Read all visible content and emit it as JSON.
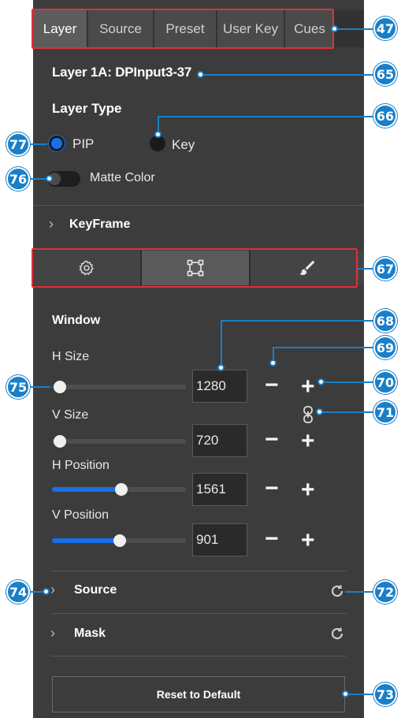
{
  "tabs": [
    "Layer",
    "Source",
    "Preset",
    "User Key",
    "Cues"
  ],
  "layer_title": "Layer 1A: DPInput3-37",
  "layer_type": {
    "heading": "Layer Type",
    "options": [
      "PIP",
      "Key"
    ],
    "selected": "PIP"
  },
  "matte_color": {
    "label": "Matte Color",
    "on": false
  },
  "keyframe": {
    "label": "KeyFrame"
  },
  "icon_tabs": [
    "gear-icon",
    "transform-icon",
    "brush-icon"
  ],
  "window": {
    "heading": "Window",
    "h_size": {
      "label": "H Size",
      "value": "1280",
      "slider_fraction": 0.0
    },
    "v_size": {
      "label": "V Size",
      "value": "720",
      "slider_fraction": 0.0
    },
    "h_position": {
      "label": "H Position",
      "value": "1561",
      "slider_fraction": 0.55
    },
    "v_position": {
      "label": "V Position",
      "value": "901",
      "slider_fraction": 0.55
    },
    "minus": "−",
    "plus": "+"
  },
  "source_section": {
    "label": "Source"
  },
  "mask_section": {
    "label": "Mask"
  },
  "reset_label": "Reset to Default",
  "callouts": {
    "c47": "47",
    "c65": "65",
    "c66": "66",
    "c77": "77",
    "c76": "76",
    "c67": "67",
    "c68": "68",
    "c69": "69",
    "c75": "75",
    "c70": "70",
    "c71": "71",
    "c74": "74",
    "c72": "72",
    "c73": "73"
  },
  "colors": {
    "accent": "#1a6fe8",
    "callout": "#1a7fc8",
    "highlight": "#e0303c",
    "panel": "#3c3c3c"
  }
}
